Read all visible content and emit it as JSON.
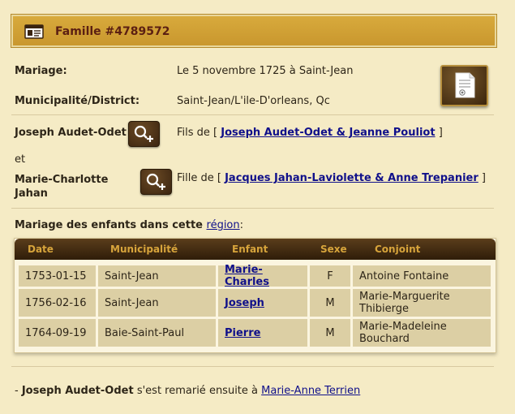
{
  "header": {
    "title": "Famille #4789572",
    "icon": "id-card-icon"
  },
  "mariage": {
    "label": "Mariage:",
    "value": "Le 5 novembre 1725 à Saint-Jean"
  },
  "municipalite": {
    "label": "Municipalité/District:",
    "value": "Saint-Jean/L'ile-D'orleans, Qc"
  },
  "husband": {
    "name": "Joseph Audet-Odet",
    "parents_prefix": "Fils de [",
    "parents_link": "Joseph Audet-Odet & Jeanne Pouliot",
    "parents_suffix": "]"
  },
  "connector": "et",
  "wife": {
    "name_line1": "Marie-Charlotte",
    "name_line2": "Jahan",
    "parents_prefix": "Fille de [",
    "parents_link": "Jacques Jahan-Laviolette & Anne Trepanier",
    "parents_suffix": "]"
  },
  "children_section": {
    "title_prefix": "Mariage des enfants dans cette",
    "title_link": "région",
    "title_suffix": ":"
  },
  "table": {
    "headers": [
      "Date",
      "Municipalité",
      "Enfant",
      "Sexe",
      "Conjoint"
    ],
    "rows": [
      {
        "date": "1753-01-15",
        "municipalite": "Saint-Jean",
        "enfant": "Marie-Charles",
        "sexe": "F",
        "conjoint1": "Antoine Fontaine",
        "conjoint2": ""
      },
      {
        "date": "1756-02-16",
        "municipalite": "Saint-Jean",
        "enfant": "Joseph",
        "sexe": "M",
        "conjoint1": "Marie-Marguerite",
        "conjoint2": "Thibierge"
      },
      {
        "date": "1764-09-19",
        "municipalite": "Baie-Saint-Paul",
        "enfant": "Pierre",
        "sexe": "M",
        "conjoint1": "Marie-Madeleine",
        "conjoint2": "Bouchard"
      }
    ]
  },
  "remarriage": {
    "prefix": "- ",
    "name": "Joseph Audet-Odet",
    "text": " s'est remarié ensuite à ",
    "spouse_link": "Marie-Anne Terrien"
  },
  "colors": {
    "background": "#f5ebc5",
    "header": "#d1a036",
    "header_text": "#5b1f12",
    "link": "#10108a"
  }
}
